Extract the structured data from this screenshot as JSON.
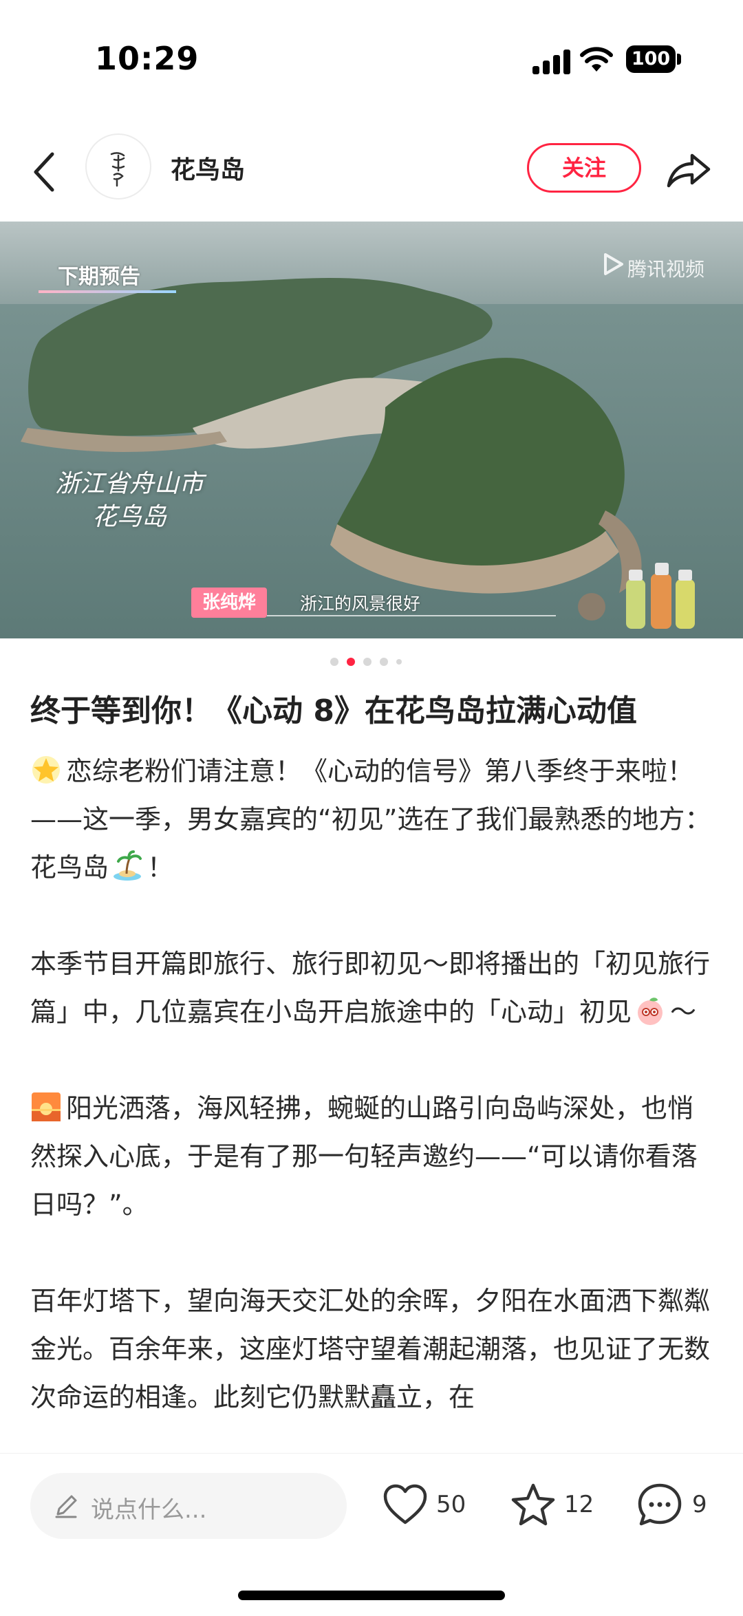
{
  "status_bar": {
    "time": "10:29",
    "battery": "100"
  },
  "header": {
    "author_name": "花鸟岛",
    "follow_label": "关注"
  },
  "media": {
    "preview_label": "下期预告",
    "watermark": "腾讯视频",
    "location_line1": "浙江省舟山市",
    "location_line2": "花鸟岛",
    "subtitle_name": "张纯烨",
    "subtitle_text": "浙江的风景很好",
    "pager": {
      "count": 5,
      "active_index": 1
    }
  },
  "post": {
    "title": "终于等到你！《心动 8》在花鸟岛拉满心动值",
    "paragraphs": [
      {
        "emoji_before": "star-emoji",
        "text": "恋综老粉们请注意！《心动的信号》第八季终于来啦！——这一季，男女嘉宾的“初见”选在了我们最熟悉的地方：花鸟岛",
        "emoji_after": "island-emoji",
        "text_after": "！"
      },
      {
        "text": "本季节目开篇即旅行、旅行即初见～即将播出的「初见旅行篇」中，几位嘉宾在小岛开启旅途中的「心动」初见",
        "emoji_after": "peach-emoji",
        "text_after": "～"
      },
      {
        "emoji_before": "sunset-emoji",
        "text": "阳光洒落，海风轻拂，蜿蜒的山路引向岛屿深处，也悄然探入心底，于是有了那一句轻声邀约——“可以请你看落日吗？”。"
      },
      {
        "text": "百年灯塔下，望向海天交汇处的余晖，夕阳在水面洒下粼粼金光。百余年来，这座灯塔守望着潮起潮落，也见证了无数次命运的相逢。此刻它仍默默矗立，在"
      }
    ]
  },
  "bottom_bar": {
    "comment_placeholder": "说点什么...",
    "likes": "50",
    "collects": "12",
    "comments": "9"
  }
}
